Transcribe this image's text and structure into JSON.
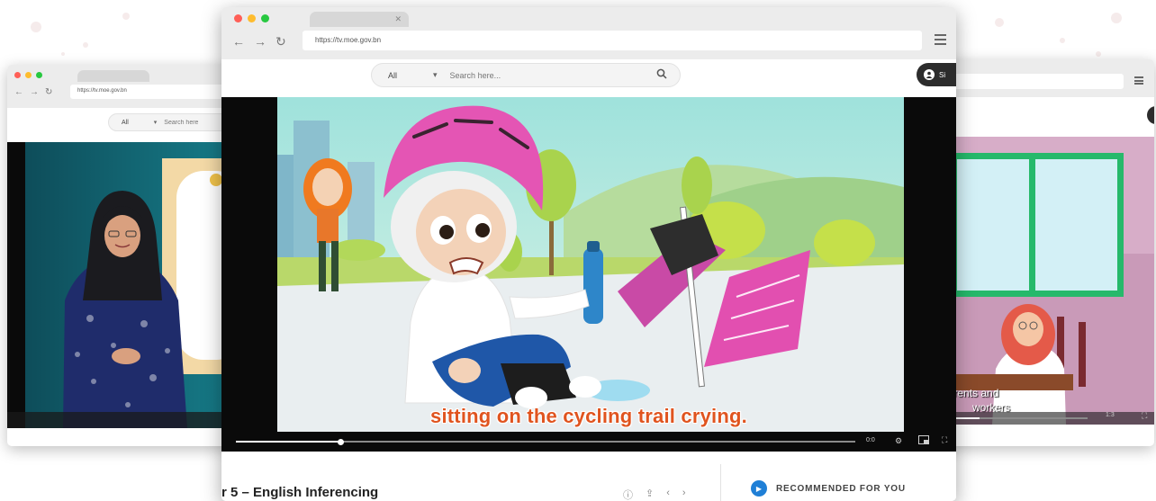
{
  "colors": {
    "accent_caption": "#e0541f",
    "recommended_icon": "#1f7fd6",
    "traffic_red": "#ff5f57",
    "traffic_yellow": "#febc2e",
    "traffic_green": "#28c840"
  },
  "windows": {
    "left": {
      "url": "https://tv.moe.gov.bn",
      "search": {
        "filter": "All",
        "placeholder": "Search here"
      }
    },
    "center": {
      "url": "https://tv.moe.gov.bn",
      "search": {
        "filter": "All",
        "placeholder": "Search here..."
      },
      "account_label": "Si",
      "video": {
        "caption": "sitting on the cycling trail crying.",
        "progress_fraction": 0.17,
        "time": "0:0"
      },
      "page_title": "r 5 – English Inferencing",
      "recommended_label": "RECOMMENDED FOR YOU"
    },
    "right": {
      "caption_line1": "parents and",
      "caption_line2": "workers",
      "time": "1:3"
    }
  },
  "icons": {
    "back": "back-arrow-icon",
    "forward": "forward-arrow-icon",
    "reload": "reload-icon",
    "search": "search-icon",
    "menu": "hamburger-menu-icon",
    "user": "user-icon",
    "fullscreen": "fullscreen-icon",
    "pip": "picture-in-picture-icon"
  }
}
